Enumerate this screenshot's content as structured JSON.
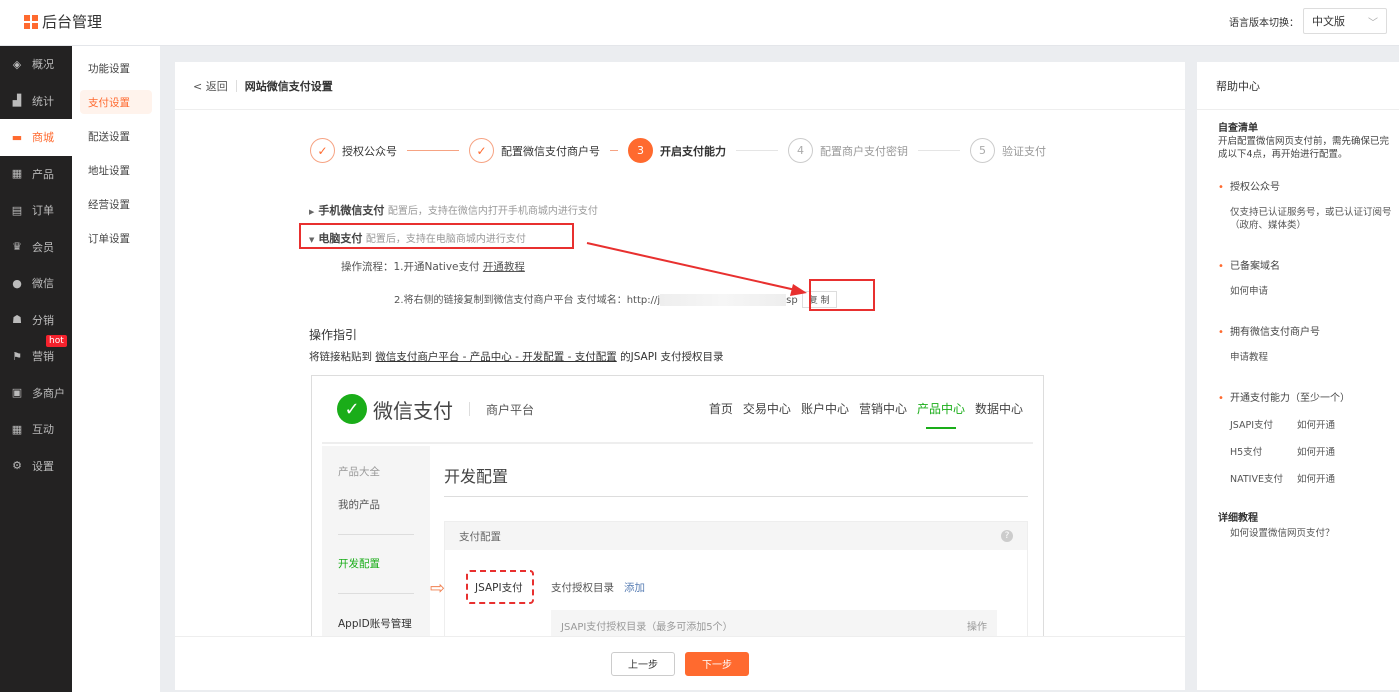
{
  "header": {
    "app_title": "后台管理",
    "lang_label": "语言版本切换：",
    "lang_value": "中文版"
  },
  "sidebar": {
    "items": [
      {
        "label": "概况",
        "icon": "layers-icon"
      },
      {
        "label": "统计",
        "icon": "chart-icon"
      },
      {
        "label": "商城",
        "icon": "shop-icon",
        "active": true
      },
      {
        "label": "产品",
        "icon": "grid-icon"
      },
      {
        "label": "订单",
        "icon": "clipboard-icon"
      },
      {
        "label": "会员",
        "icon": "crown-icon"
      },
      {
        "label": "微信",
        "icon": "wechat-icon"
      },
      {
        "label": "分销",
        "icon": "user-icon"
      },
      {
        "label": "营销",
        "icon": "flag-icon",
        "badge": "hot"
      },
      {
        "label": "多商户",
        "icon": "store-icon"
      },
      {
        "label": "互动",
        "icon": "apps-icon"
      },
      {
        "label": "设置",
        "icon": "gear-icon"
      }
    ]
  },
  "subnav": {
    "items": [
      "功能设置",
      "支付设置",
      "配送设置",
      "地址设置",
      "经营设置",
      "订单设置"
    ],
    "active": 1
  },
  "card": {
    "back": "< 返回",
    "title": "网站微信支付设置",
    "steps": [
      {
        "num": "✓",
        "label": "授权公众号"
      },
      {
        "num": "✓",
        "label": "配置微信支付商户号"
      },
      {
        "num": "3",
        "label": "开启支付能力"
      },
      {
        "num": "4",
        "label": "配置商户支付密钥"
      },
      {
        "num": "5",
        "label": "验证支付"
      }
    ],
    "mobile_title": "手机微信支付",
    "mobile_hint": "配置后，支持在微信内打开手机商城内进行支付",
    "pc_title": "电脑支付",
    "pc_hint": "配置后，支持在电脑商城内进行支付",
    "flow1": "操作流程：1.开通Native支付",
    "flow1_link": "开通教程",
    "flow2": "2.将右侧的链接复制到微信支付商户平台  支付域名：http://j",
    "flow2_tail": "sp",
    "copy": "复 制",
    "guide_title": "操作指引",
    "guide_prefix": "将链接粘贴到",
    "guide_link": "微信支付商户平台 - 产品中心 - 开发配置 - 支付配置",
    "guide_suffix": "的JSAPI 支付授权目录",
    "prev": "上一步",
    "next": "下一步"
  },
  "wxshot": {
    "brand": "微信支付",
    "sub": "商户平台",
    "nav": [
      "首页",
      "交易中心",
      "账户中心",
      "营销中心",
      "产品中心",
      "数据中心"
    ],
    "left": [
      "产品大全",
      "我的产品",
      "开发配置",
      "AppID账号管理"
    ],
    "page_title": "开发配置",
    "panel_title": "支付配置",
    "jsapi": "JSAPI支付",
    "dir_label": "支付授权目录",
    "add": "添加",
    "table_head": "JSAPI支付授权目录（最多可添加5个）",
    "op": "操作"
  },
  "help": {
    "title": "帮助中心",
    "check_title": "自查清单",
    "check_desc": "开启配置微信网页支付前，需先确保已完成以下4点，再开始进行配置。",
    "p1": "授权公众号",
    "p1_desc": "仅支持已认证服务号，或已认证订阅号（政府、媒体类）",
    "p2": "已备案域名",
    "p2_link": "如何申请",
    "p3": "拥有微信支付商户号",
    "p3_link": "申请教程",
    "p4": "开通支付能力（至少一个）",
    "pays": [
      {
        "name": "JSAPI支付",
        "link": "如何开通"
      },
      {
        "name": "H5支付",
        "link": "如何开通"
      },
      {
        "name": "NATIVE支付",
        "link": "如何开通"
      }
    ],
    "tut_title": "详细教程",
    "tut_link": "如何设置微信网页支付？"
  },
  "colors": {
    "accent": "#ff6a2f",
    "sidebar": "#232222",
    "wechat": "#1aad19",
    "annot": "#e8302f"
  }
}
